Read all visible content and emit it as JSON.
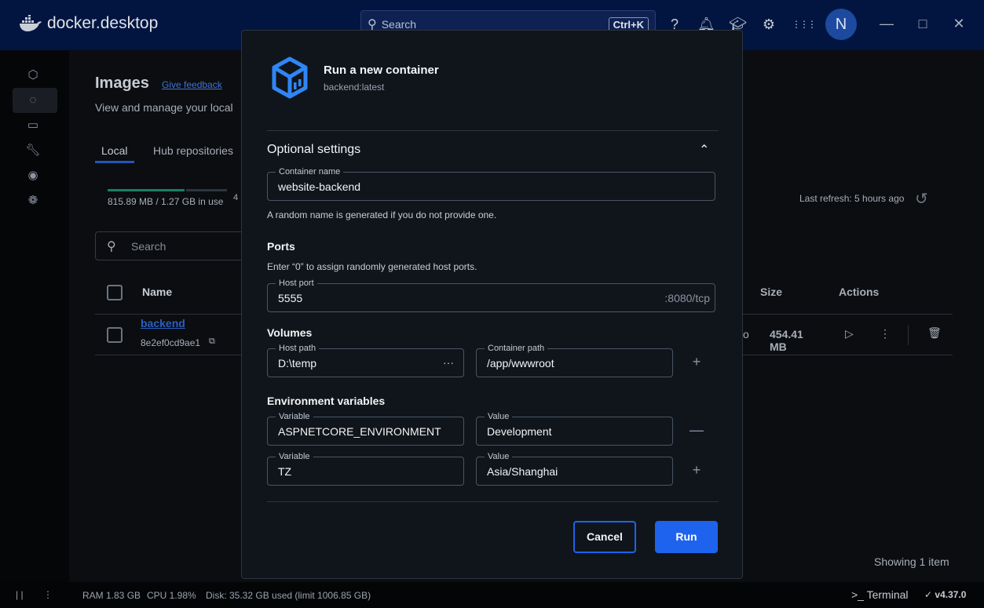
{
  "app": {
    "logo_text_bold": "docker",
    "logo_text": "desktop",
    "search_placeholder": "Search",
    "search_shortcut": "Ctrl+K",
    "avatar_initial": "N"
  },
  "page": {
    "title": "Images",
    "feedback_link": "Give feedback",
    "subtitle": "View and manage your local",
    "tabs": [
      {
        "label": "Local",
        "active": true
      },
      {
        "label": "Hub repositories",
        "active": false
      }
    ],
    "usage": "815.89 MB / 1.27 GB in use",
    "usage_extra": "4",
    "usage_fraction": 0.63,
    "last_refresh": "Last refresh: 5 hours ago",
    "search_placeholder": "Search",
    "columns": {
      "name": "Name",
      "size": "Size",
      "actions": "Actions"
    },
    "rows": [
      {
        "name": "backend",
        "id": "8e2ef0cd9ae1",
        "size": "454.41 MB",
        "partial": "o"
      }
    ],
    "footer": "Showing 1 item"
  },
  "status": {
    "ram": "RAM 1.83 GB",
    "cpu": "CPU 1.98%",
    "disk": "Disk: 35.32 GB used (limit 1006.85 GB)",
    "terminal": "Terminal",
    "version": "v4.37.0"
  },
  "modal": {
    "title": "Run a new container",
    "image": "backend:latest",
    "optional": "Optional settings",
    "container_name": {
      "label": "Container name",
      "value": "website-backend",
      "help": "A random name is generated if you do not provide one."
    },
    "ports": {
      "heading": "Ports",
      "help": "Enter “0” to assign randomly generated host ports.",
      "label": "Host port",
      "value": "5555",
      "suffix": ":8080/tcp"
    },
    "volumes": {
      "heading": "Volumes",
      "host_label": "Host path",
      "host_value": "D:\\temp",
      "browse": "···",
      "container_label": "Container path",
      "container_value": "/app/wwwroot"
    },
    "env": {
      "heading": "Environment variables",
      "rows": [
        {
          "var_label": "Variable",
          "var": "ASPNETCORE_ENVIRONMENT",
          "val_label": "Value",
          "val": "Development"
        },
        {
          "var_label": "Variable",
          "var": "TZ",
          "val_label": "Value",
          "val": "Asia/Shanghai"
        }
      ]
    },
    "cancel": "Cancel",
    "run": "Run"
  },
  "colors": {
    "accent": "#1d63ed",
    "header": "#021540",
    "modal_bg": "#10151b",
    "usage_bar": "#1a7f64"
  }
}
